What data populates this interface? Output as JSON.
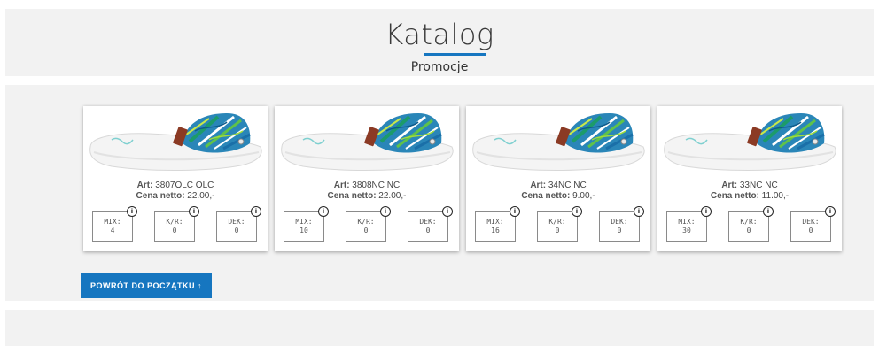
{
  "header": {
    "title": "Katalog",
    "subtitle": "Promocje"
  },
  "colors": {
    "accent": "#1676c0",
    "band": "#f2f2f2"
  },
  "products": [
    {
      "art_label": "Art:",
      "art_value": " 3807OLC OLC",
      "price_label": "Cena netto:",
      "price_value": " 22.00,-",
      "image_icon": "sandal-image",
      "fields": [
        {
          "label": "MIX:",
          "value": "4"
        },
        {
          "label": "K/R:",
          "value": "0"
        },
        {
          "label": "DEK:",
          "value": "0"
        }
      ]
    },
    {
      "art_label": "Art:",
      "art_value": " 3808NC NC",
      "price_label": "Cena netto:",
      "price_value": " 22.00,-",
      "image_icon": "sandal-image",
      "fields": [
        {
          "label": "MIX:",
          "value": "10"
        },
        {
          "label": "K/R:",
          "value": "0"
        },
        {
          "label": "DEK:",
          "value": "0"
        }
      ]
    },
    {
      "art_label": "Art:",
      "art_value": " 34NC NC",
      "price_label": "Cena netto:",
      "price_value": " 9.00,-",
      "image_icon": "sandal-image",
      "fields": [
        {
          "label": "MIX:",
          "value": "16"
        },
        {
          "label": "K/R:",
          "value": "0"
        },
        {
          "label": "DEK:",
          "value": "0"
        }
      ]
    },
    {
      "art_label": "Art:",
      "art_value": " 33NC NC",
      "price_label": "Cena netto:",
      "price_value": " 11.00,-",
      "image_icon": "sandal-image",
      "fields": [
        {
          "label": "MIX:",
          "value": "30"
        },
        {
          "label": "K/R:",
          "value": "0"
        },
        {
          "label": "DEK:",
          "value": "0"
        }
      ]
    }
  ],
  "info_icon_glyph": "i",
  "back_button_label": "POWRÓT DO POCZĄTKU ↑"
}
